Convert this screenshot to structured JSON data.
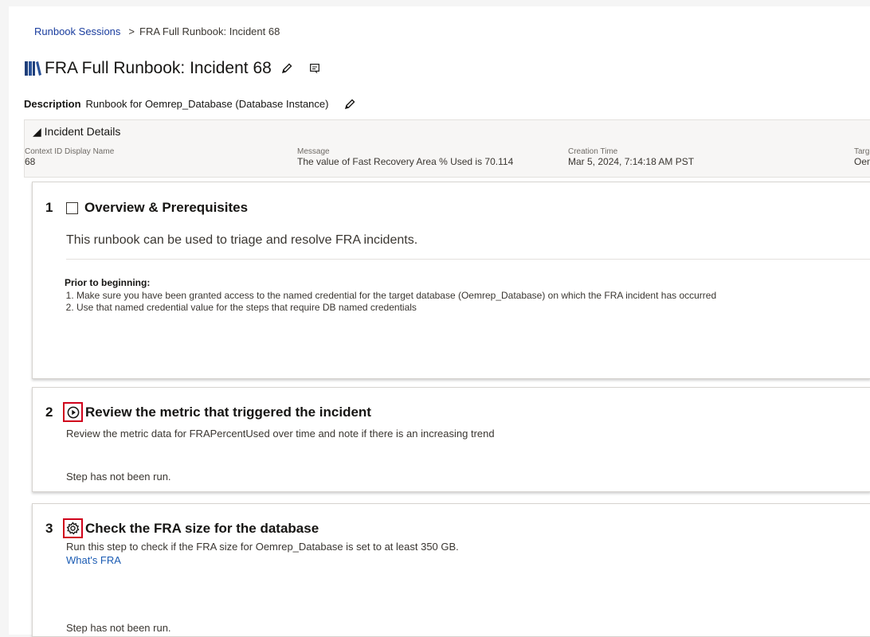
{
  "breadcrumb": {
    "root": "Runbook Sessions",
    "separator": ">",
    "current": "FRA Full Runbook: Incident 68"
  },
  "header": {
    "title": "FRA Full Runbook: Incident 68"
  },
  "description": {
    "label": "Description",
    "value": "Runbook for Oemrep_Database (Database Instance)"
  },
  "incident": {
    "heading": "◢ Incident Details",
    "fields": [
      {
        "label": "Context ID Display Name",
        "value": "68"
      },
      {
        "label": "Message",
        "value": "The value of Fast Recovery Area % Used is 70.114"
      },
      {
        "label": "Creation Time",
        "value": "Mar 5, 2024, 7:14:18 AM PST"
      },
      {
        "label": "Targe",
        "value": "Oem"
      }
    ]
  },
  "steps": [
    {
      "number": "1",
      "title": "Overview & Prerequisites",
      "intro": "This runbook can be used to triage and resolve FRA incidents.",
      "prior_label": "Prior to beginning:",
      "items": [
        "Make sure you have been granted access to the named credential for the target database (Oemrep_Database) on which the FRA incident has occurred",
        "Use that named credential value for the steps that require DB named credentials"
      ]
    },
    {
      "number": "2",
      "title": "Review the metric that triggered the incident",
      "description": "Review the metric data for FRAPercentUsed over time and note if there is an increasing trend",
      "status": "Step has not been run."
    },
    {
      "number": "3",
      "title": "Check the FRA size for the database",
      "description": "Run this step to check if the FRA size for Oemrep_Database is set to at least 350 GB.",
      "link": "What's FRA",
      "status": "Step has not been run."
    }
  ],
  "colors": {
    "link": "#1a3d9e",
    "highlight": "#d0021b"
  }
}
